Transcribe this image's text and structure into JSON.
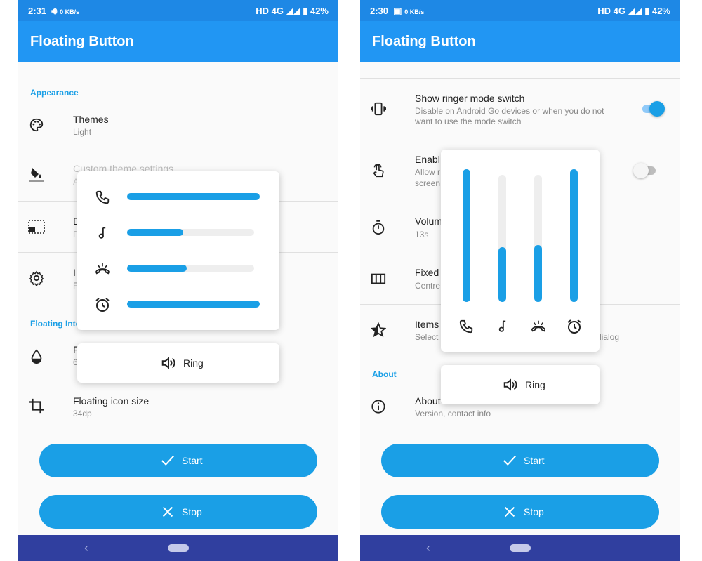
{
  "left": {
    "status": {
      "time": "2:31",
      "net_speed": "0 KB/s",
      "right": "HD 4G",
      "battery": "42%"
    },
    "app_title": "Floating Button",
    "sections": {
      "appearance": "Appearance",
      "floating": "Floating Into"
    },
    "rows": [
      {
        "title": "Themes",
        "subtitle": "Light",
        "icon": "palette-icon"
      },
      {
        "title": "Custom theme settings",
        "subtitle": "A",
        "icon": "paint-bucket-icon"
      },
      {
        "title": "D",
        "subtitle": "D",
        "icon": "dotted-screen-icon"
      },
      {
        "title": "I",
        "subtitle": "F",
        "icon": "gear-icon"
      },
      {
        "title": "F",
        "subtitle": "6",
        "icon": "opacity-drop-icon"
      },
      {
        "title": "Floating icon size",
        "subtitle": "34dp",
        "icon": "crop-icon"
      }
    ],
    "volume_levels": {
      "call": 1.0,
      "media": 0.44,
      "ring": 0.47,
      "alarm": 1.0
    },
    "ring_mode": "Ring",
    "buttons": {
      "start": "Start",
      "stop": "Stop"
    }
  },
  "right": {
    "status": {
      "time": "2:30",
      "net_speed": "0 KB/s",
      "right": "HD 4G",
      "battery": "42%"
    },
    "app_title": "Floating Button",
    "sections": {
      "about": "About"
    },
    "rows": [
      {
        "title": "Show ringer mode switch",
        "subtitle": "Disable on Android Go devices or when you do not",
        "subtitle2": "want to use the mode switch",
        "icon": "vibrate-icon",
        "toggle": true
      },
      {
        "title": "Enabl",
        "subtitle": "Allow r",
        "subtitle2": "screen",
        "icon": "touch-icon",
        "toggle": false
      },
      {
        "title": "Volum",
        "subtitle": "13s",
        "icon": "timer-icon"
      },
      {
        "title": "Fixed",
        "subtitle": "Centre",
        "icon": "columns-icon"
      },
      {
        "title": "Items",
        "subtitle": "Select",
        "subtitle_tail": "dialog",
        "icon": "star-half-icon"
      },
      {
        "title": "About",
        "subtitle": "Version, contact info",
        "icon": "info-icon"
      }
    ],
    "volume_levels": {
      "call": 1.0,
      "media": 0.43,
      "ring": 0.45,
      "alarm": 1.0
    },
    "ring_mode": "Ring",
    "buttons": {
      "start": "Start",
      "stop": "Stop"
    }
  },
  "colors": {
    "appbar": "#2196f3",
    "statusbar": "#1e88e5",
    "accent": "#1a9fe6",
    "navbar": "#303f9f"
  }
}
